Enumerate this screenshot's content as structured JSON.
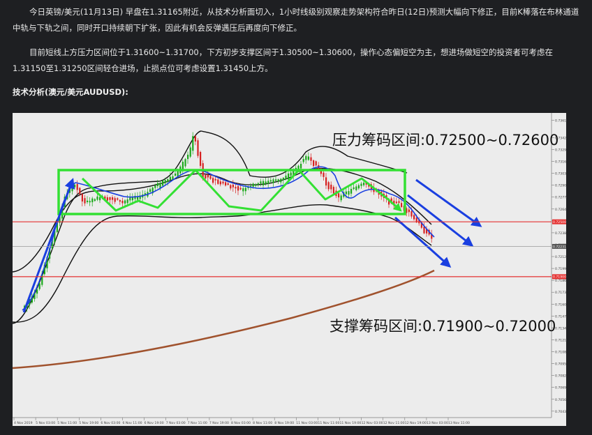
{
  "article": {
    "paragraph1": "今日英镑/美元(11月13日) 早盘在1.31165附近，从技术分析面切入，1小时线级别观察走势架构符合昨日(12日)预测大幅向下修正，目前K棒落在布林通道中轨与下轨之间，同时开口持续朝下扩张，因此有机会反弹遇压后再度向下修正。",
    "paragraph2": "目前短线上方压力区间位于1.31600~1.31700，下方初步支撑区间于1.30500~1.30600，操作心态偏短空为主，想进场做短空的投资者可考虑在1.31150至1.31250区间轻仓进场，止损点位可考虑设置1.31450上方。",
    "section_heading": "技术分析(澳元/美元AUDUSD):"
  },
  "chart_data": {
    "type": "line",
    "instrument": "AUDUSD",
    "resistance_label": "压力筹码区间:0.72500~0.72600",
    "support_label": "支撑筹码区间:0.71900~0.72000",
    "resistance_zone": [
      0.725,
      0.726
    ],
    "support_zone": [
      0.719,
      0.72
    ],
    "ylim": [
      0.7036,
      0.7369
    ],
    "y_ticks": [
      "0.73610",
      "0.73420",
      "0.73290",
      "0.73160",
      "0.73030",
      "0.72900",
      "0.72770",
      "0.72640",
      "0.72510",
      "0.72380",
      "0.72250",
      "0.72120",
      "0.71990",
      "0.71860",
      "0.71730",
      "0.71600",
      "0.71470",
      "0.71340",
      "0.71210",
      "0.71080",
      "0.70950",
      "0.70820",
      "0.70690",
      "0.70560",
      "0.70430"
    ],
    "price_tags": [
      {
        "label": "0.72500",
        "value": 0.725,
        "color": "#e53030"
      },
      {
        "label": "0.72231",
        "value": 0.72231,
        "color": "#555555"
      },
      {
        "label": "0.71900",
        "value": 0.719,
        "color": "#e53030"
      }
    ],
    "x_ticks": [
      "4 Nov 2019",
      "5 Nov 03:00",
      "5 Nov 11:00",
      "5 Nov 19:00",
      "6 Nov 03:00",
      "6 Nov 11:00",
      "6 Nov 19:00",
      "7 Nov 03:00",
      "7 Nov 11:00",
      "7 Nov 19:00",
      "8 Nov 03:00",
      "8 Nov 11:00",
      "8 Nov 19:00",
      "11 Nov 03:00",
      "11 Nov 11:00",
      "11 Nov 19:00",
      "12 Nov 03:00",
      "12 Nov 11:00",
      "12 Nov 19:00",
      "13 Nov 03:00",
      "13 Nov 11:00"
    ],
    "consolidation_box": {
      "upper": 0.7282,
      "lower": 0.7252
    },
    "series": [],
    "colors": {
      "resistance_line": "#e53030",
      "support_line": "#e53030",
      "box": "#33e033",
      "trend_arrows": "#1a3fe0",
      "moving_average": "#a0522d"
    }
  }
}
